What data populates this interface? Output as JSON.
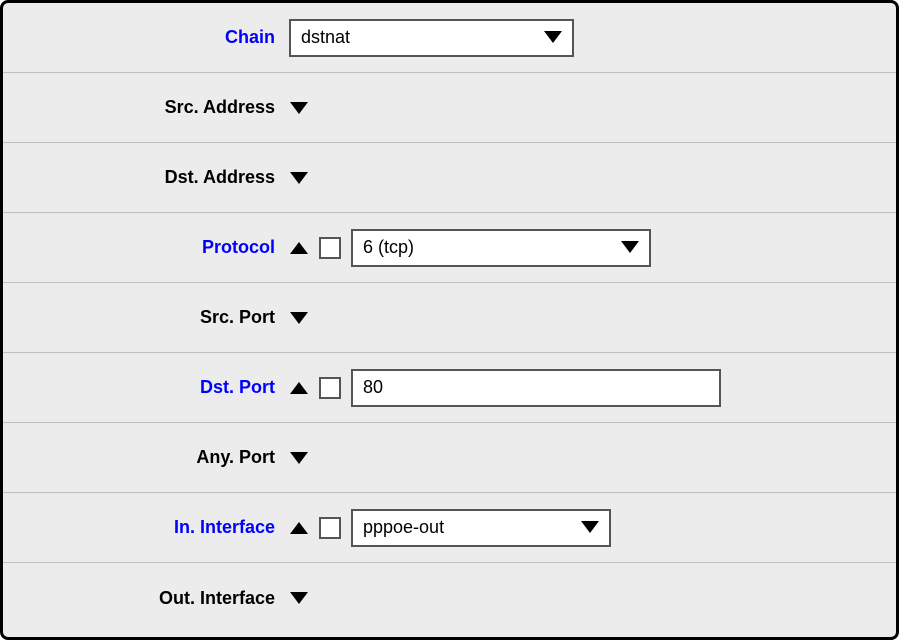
{
  "rows": {
    "chain": {
      "label": "Chain",
      "active": true,
      "expanded": null,
      "value": "dstnat"
    },
    "srcAddress": {
      "label": "Src. Address",
      "active": false,
      "expanded": false
    },
    "dstAddress": {
      "label": "Dst. Address",
      "active": false,
      "expanded": false
    },
    "protocol": {
      "label": "Protocol",
      "active": true,
      "expanded": true,
      "value": "6 (tcp)"
    },
    "srcPort": {
      "label": "Src. Port",
      "active": false,
      "expanded": false
    },
    "dstPort": {
      "label": "Dst. Port",
      "active": true,
      "expanded": true,
      "value": "80"
    },
    "anyPort": {
      "label": "Any. Port",
      "active": false,
      "expanded": false
    },
    "inInterface": {
      "label": "In. Interface",
      "active": true,
      "expanded": true,
      "value": "pppoe-out"
    },
    "outInterface": {
      "label": "Out. Interface",
      "active": false,
      "expanded": false
    }
  }
}
